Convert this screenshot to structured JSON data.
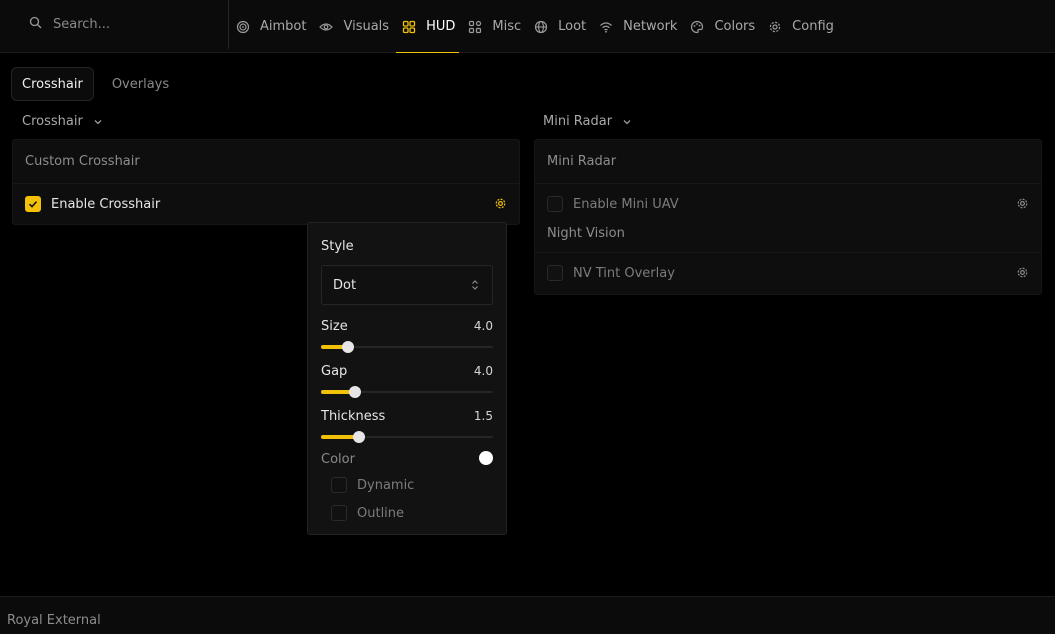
{
  "search": {
    "placeholder": "Search..."
  },
  "nav": {
    "items": [
      {
        "label": "Aimbot"
      },
      {
        "label": "Visuals"
      },
      {
        "label": "HUD"
      },
      {
        "label": "Misc"
      },
      {
        "label": "Loot"
      },
      {
        "label": "Network"
      },
      {
        "label": "Colors"
      },
      {
        "label": "Config"
      }
    ],
    "active": "HUD"
  },
  "subtabs": [
    {
      "label": "Crosshair",
      "active": true
    },
    {
      "label": "Overlays",
      "active": false
    }
  ],
  "left": {
    "header": "Crosshair",
    "panel_title": "Custom Crosshair",
    "enable_crosshair": {
      "label": "Enable Crosshair",
      "checked": true
    }
  },
  "right": {
    "header": "Mini Radar",
    "panel_title": "Mini Radar",
    "enable_mini_uav": {
      "label": "Enable Mini UAV",
      "checked": false
    },
    "night_vision_label": "Night Vision",
    "nv_tint_overlay": {
      "label": "NV Tint Overlay",
      "checked": false
    }
  },
  "popover": {
    "style_label": "Style",
    "style_value": "Dot",
    "size": {
      "label": "Size",
      "value": "4.0",
      "fraction": 0.155
    },
    "gap": {
      "label": "Gap",
      "value": "4.0",
      "fraction": 0.195
    },
    "thickness": {
      "label": "Thickness",
      "value": "1.5",
      "fraction": 0.22
    },
    "color_label": "Color",
    "color_value": "#ffffff",
    "dynamic": {
      "label": "Dynamic",
      "checked": false
    },
    "outline": {
      "label": "Outline",
      "checked": false
    }
  },
  "footer": {
    "brand": "Royal External"
  },
  "colors": {
    "accent": "#f2c20a",
    "background": "#000000",
    "panel": "#0e0e0e"
  }
}
